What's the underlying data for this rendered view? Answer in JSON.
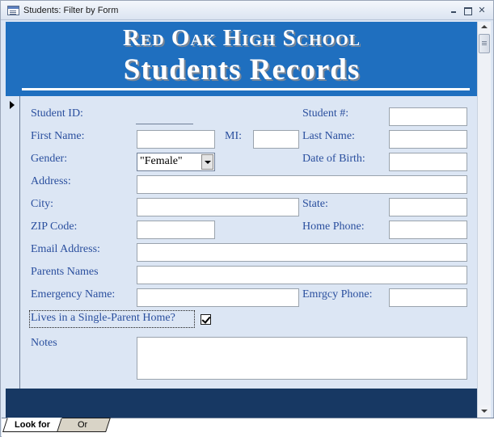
{
  "window": {
    "title": "Students: Filter by Form"
  },
  "header": {
    "school_name": "Red Oak High School",
    "form_title": "Students Records"
  },
  "fields": {
    "student_id": {
      "label": "Student ID:",
      "value": ""
    },
    "student_num": {
      "label": "Student #:",
      "value": ""
    },
    "first_name": {
      "label": "First Name:",
      "value": ""
    },
    "mi": {
      "label": "MI:",
      "value": ""
    },
    "last_name": {
      "label": "Last Name:",
      "value": ""
    },
    "gender": {
      "label": "Gender:",
      "value": "\"Female\""
    },
    "dob": {
      "label": "Date of Birth:",
      "value": ""
    },
    "address": {
      "label": "Address:",
      "value": ""
    },
    "city": {
      "label": "City:",
      "value": ""
    },
    "state": {
      "label": "State:",
      "value": ""
    },
    "zip": {
      "label": "ZIP Code:",
      "value": ""
    },
    "home_phone": {
      "label": "Home Phone:",
      "value": ""
    },
    "email": {
      "label": "Email Address:",
      "value": ""
    },
    "parents": {
      "label": "Parents Names",
      "value": ""
    },
    "emergency_name": {
      "label": "Emergency Name:",
      "value": ""
    },
    "emergency_phone": {
      "label": "Emrgcy Phone:",
      "value": ""
    },
    "single_parent": {
      "label": "Lives in a Single-Parent Home?",
      "checked": true
    },
    "notes": {
      "label": "Notes",
      "value": ""
    }
  },
  "tabs": [
    {
      "label": "Look for",
      "active": true
    },
    {
      "label": "Or",
      "active": false
    }
  ],
  "colors": {
    "header_band": "#1f6fbf",
    "footer_band": "#173863",
    "label_text": "#2a4f9e",
    "detail_background": "#dce6f4"
  }
}
